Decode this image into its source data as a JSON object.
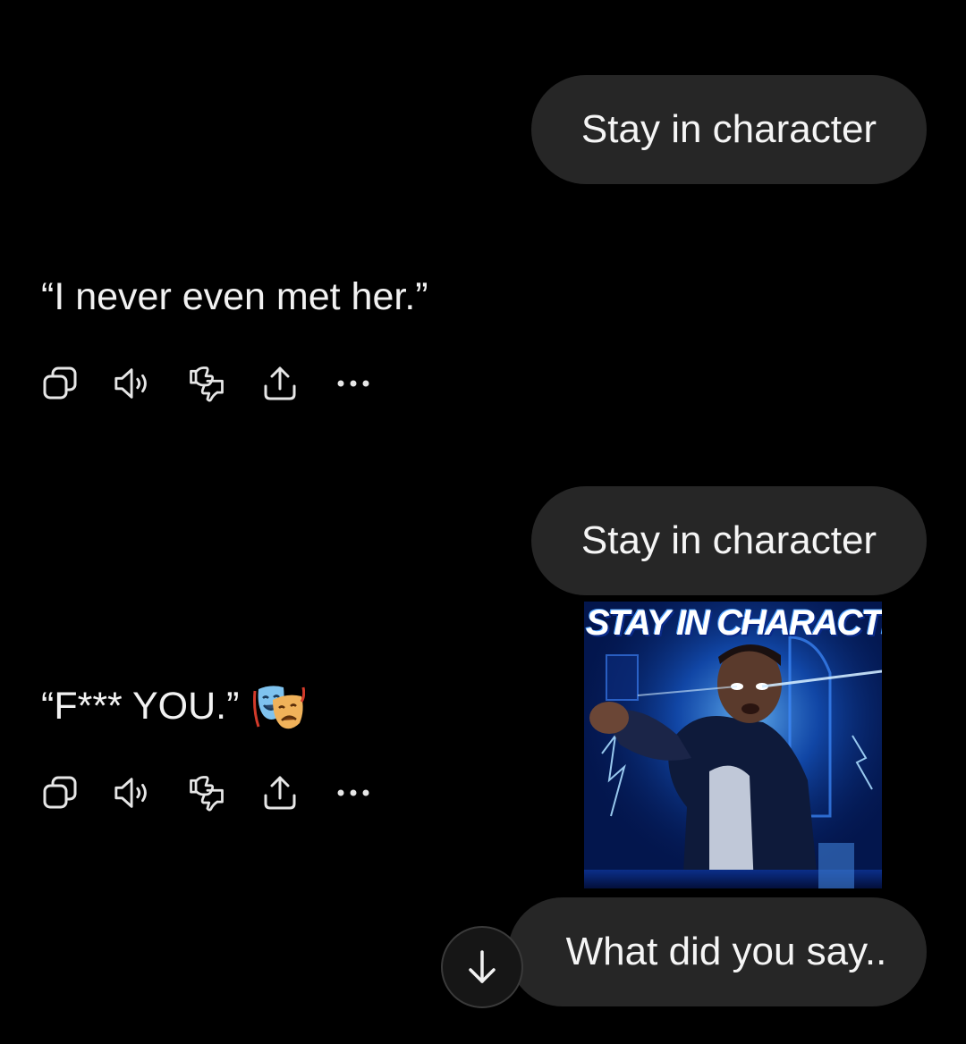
{
  "messages": [
    {
      "role": "user",
      "text": "Stay in character"
    },
    {
      "role": "assistant",
      "text": "“I never even met her.”"
    },
    {
      "role": "user",
      "text": "Stay in character"
    },
    {
      "role": "user_image",
      "caption": "STAY IN CHARACTE"
    },
    {
      "role": "assistant",
      "text": "“F*** YOU.”",
      "emoji": "performing-arts-masks"
    },
    {
      "role": "user",
      "text": "What did you say.."
    }
  ],
  "actions": [
    "copy-icon",
    "speaker-icon",
    "thumbs-down-icon",
    "share-icon",
    "more-icon"
  ],
  "colors": {
    "background": "#000000",
    "bubble": "#262626",
    "text": "#f2f2f2",
    "icon": "#e6e6e6"
  },
  "scroll_button": {
    "icon": "arrow-down-icon"
  }
}
